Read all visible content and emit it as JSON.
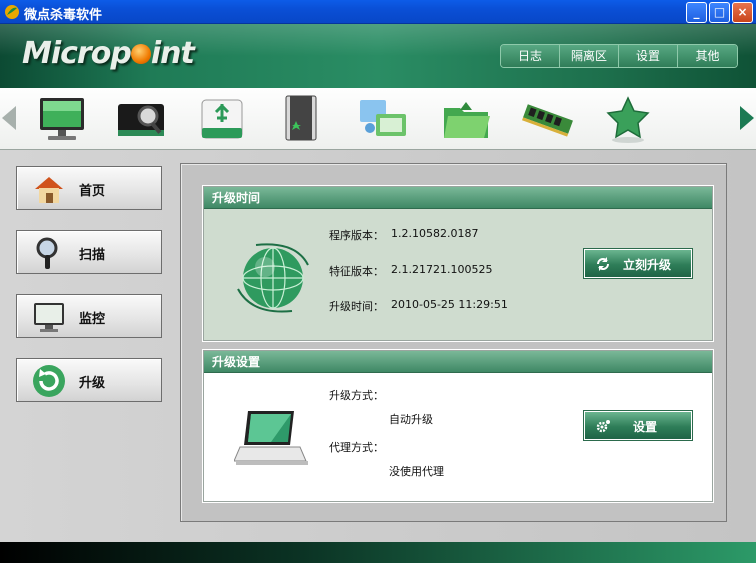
{
  "window": {
    "title": "微点杀毒软件",
    "minimize": "_",
    "maximize": "□",
    "close": "×"
  },
  "banner": {
    "logo_text_1": "Microp",
    "logo_text_2": "int",
    "menu": [
      "日志",
      "隔离区",
      "设置",
      "其他"
    ]
  },
  "toolbar": {
    "icons": [
      "monitor-icon",
      "scan-disk-icon",
      "usb-drive-icon",
      "app-folder-icon",
      "network-folder-icon",
      "open-folder-icon",
      "memory-module-icon",
      "favorites-star-icon"
    ]
  },
  "nav": {
    "items": [
      {
        "label": "首页",
        "icon": "home-icon"
      },
      {
        "label": "扫描",
        "icon": "magnifier-icon"
      },
      {
        "label": "监控",
        "icon": "monitor-icon"
      },
      {
        "label": "升级",
        "icon": "refresh-icon"
      }
    ]
  },
  "upgrade_time": {
    "header": "升级时间",
    "program_version_label": "程序版本：",
    "program_version": "1.2.10582.0187",
    "signature_version_label": "特征版本：",
    "signature_version": "2.1.21721.100525",
    "upgrade_time_label": "升级时间：",
    "upgrade_time": "2010-05-25 11:29:51",
    "button": "立刻升级"
  },
  "upgrade_settings": {
    "header": "升级设置",
    "method_label": "升级方式：",
    "method_value": "自动升级",
    "proxy_label": "代理方式：",
    "proxy_value": "没使用代理",
    "button": "设置"
  },
  "colors": {
    "accent": "#2e7d58",
    "titlebar": "#0a4fd6"
  }
}
